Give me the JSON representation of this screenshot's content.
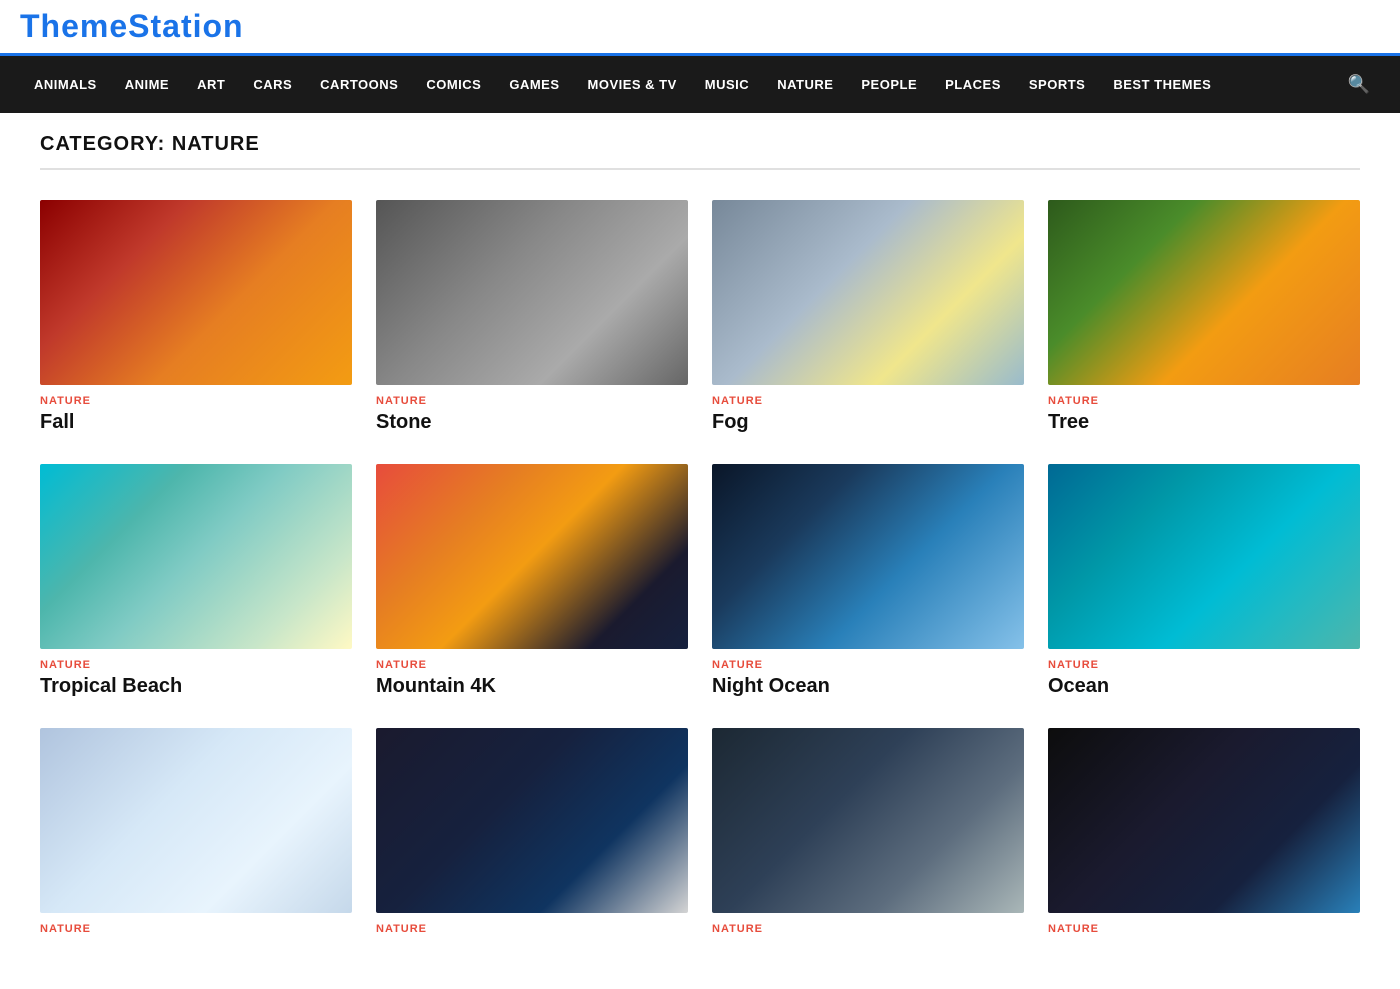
{
  "logo": {
    "text": "ThemeStation"
  },
  "nav": {
    "items": [
      {
        "label": "ANIMALS",
        "id": "animals"
      },
      {
        "label": "ANIME",
        "id": "anime"
      },
      {
        "label": "ART",
        "id": "art"
      },
      {
        "label": "CARS",
        "id": "cars"
      },
      {
        "label": "CARTOONS",
        "id": "cartoons"
      },
      {
        "label": "COMICS",
        "id": "comics"
      },
      {
        "label": "GAMES",
        "id": "games"
      },
      {
        "label": "MOVIES & TV",
        "id": "movies-tv"
      },
      {
        "label": "MUSIC",
        "id": "music"
      },
      {
        "label": "NATURE",
        "id": "nature"
      },
      {
        "label": "PEOPLE",
        "id": "people"
      },
      {
        "label": "PLACES",
        "id": "places"
      },
      {
        "label": "SPORTS",
        "id": "sports"
      },
      {
        "label": "BEST THEMES",
        "id": "best-themes"
      }
    ]
  },
  "category": {
    "label": "CATEGORY: NATURE"
  },
  "cards": [
    {
      "id": "fall",
      "category": "NATURE",
      "title": "Fall",
      "imgClass": "img-fall"
    },
    {
      "id": "stone",
      "category": "NATURE",
      "title": "Stone",
      "imgClass": "img-stone"
    },
    {
      "id": "fog",
      "category": "NATURE",
      "title": "Fog",
      "imgClass": "img-fog"
    },
    {
      "id": "tree",
      "category": "NATURE",
      "title": "Tree",
      "imgClass": "img-tree"
    },
    {
      "id": "tropical-beach",
      "category": "NATURE",
      "title": "Tropical Beach",
      "imgClass": "img-tropical"
    },
    {
      "id": "mountain-4k",
      "category": "NATURE",
      "title": "Mountain 4K",
      "imgClass": "img-mountain"
    },
    {
      "id": "night-ocean",
      "category": "NATURE",
      "title": "Night Ocean",
      "imgClass": "img-night-ocean"
    },
    {
      "id": "ocean",
      "category": "NATURE",
      "title": "Ocean",
      "imgClass": "img-ocean"
    },
    {
      "id": "snow-trees",
      "category": "NATURE",
      "title": "",
      "imgClass": "img-snow-trees"
    },
    {
      "id": "moon-scene",
      "category": "NATURE",
      "title": "",
      "imgClass": "img-moon"
    },
    {
      "id": "water-drops",
      "category": "NATURE",
      "title": "",
      "imgClass": "img-drops"
    },
    {
      "id": "earth-space",
      "category": "NATURE",
      "title": "",
      "imgClass": "img-earth"
    }
  ]
}
